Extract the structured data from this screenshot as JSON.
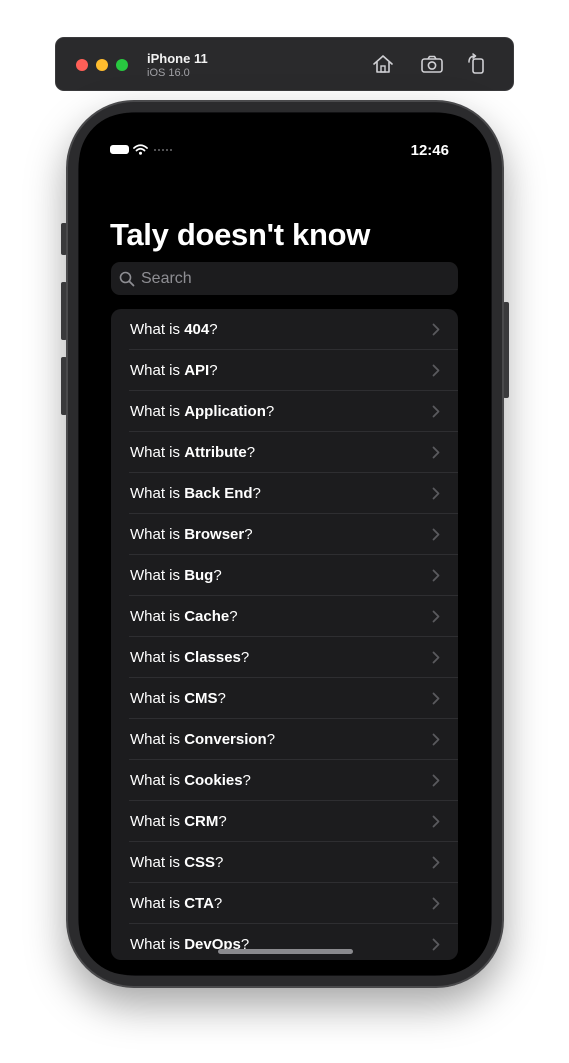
{
  "simulator": {
    "device_name": "iPhone 11",
    "os_version": "iOS 16.0",
    "tools": [
      "home-icon",
      "screenshot-icon",
      "rotate-icon"
    ]
  },
  "status_bar": {
    "time": "12:46"
  },
  "navigation": {
    "large_title": "Taly doesn't know"
  },
  "search": {
    "placeholder": "Search",
    "value": ""
  },
  "list": {
    "items": [
      {
        "prefix": "What is ",
        "term": "404",
        "suffix": "?"
      },
      {
        "prefix": "What is ",
        "term": "API",
        "suffix": "?"
      },
      {
        "prefix": "What is ",
        "term": "Application",
        "suffix": "?"
      },
      {
        "prefix": "What is ",
        "term": "Attribute",
        "suffix": "?"
      },
      {
        "prefix": "What is ",
        "term": "Back End",
        "suffix": "?"
      },
      {
        "prefix": "What is ",
        "term": "Browser",
        "suffix": "?"
      },
      {
        "prefix": "What is ",
        "term": "Bug",
        "suffix": "?"
      },
      {
        "prefix": "What is ",
        "term": "Cache",
        "suffix": "?"
      },
      {
        "prefix": "What is ",
        "term": "Classes",
        "suffix": "?"
      },
      {
        "prefix": "What is ",
        "term": "CMS",
        "suffix": "?"
      },
      {
        "prefix": "What is ",
        "term": "Conversion",
        "suffix": "?"
      },
      {
        "prefix": "What is ",
        "term": "Cookies",
        "suffix": "?"
      },
      {
        "prefix": "What is ",
        "term": "CRM",
        "suffix": "?"
      },
      {
        "prefix": "What is ",
        "term": "CSS",
        "suffix": "?"
      },
      {
        "prefix": "What is ",
        "term": "CTA",
        "suffix": "?"
      },
      {
        "prefix": "What is ",
        "term": "DevOps",
        "suffix": "?"
      }
    ]
  },
  "colors": {
    "background": "#000000",
    "grouped_cell": "#1c1c1e",
    "separator": "#2e2e31",
    "chevron": "#5a5a5e",
    "secondary_text": "#8e8e93"
  }
}
